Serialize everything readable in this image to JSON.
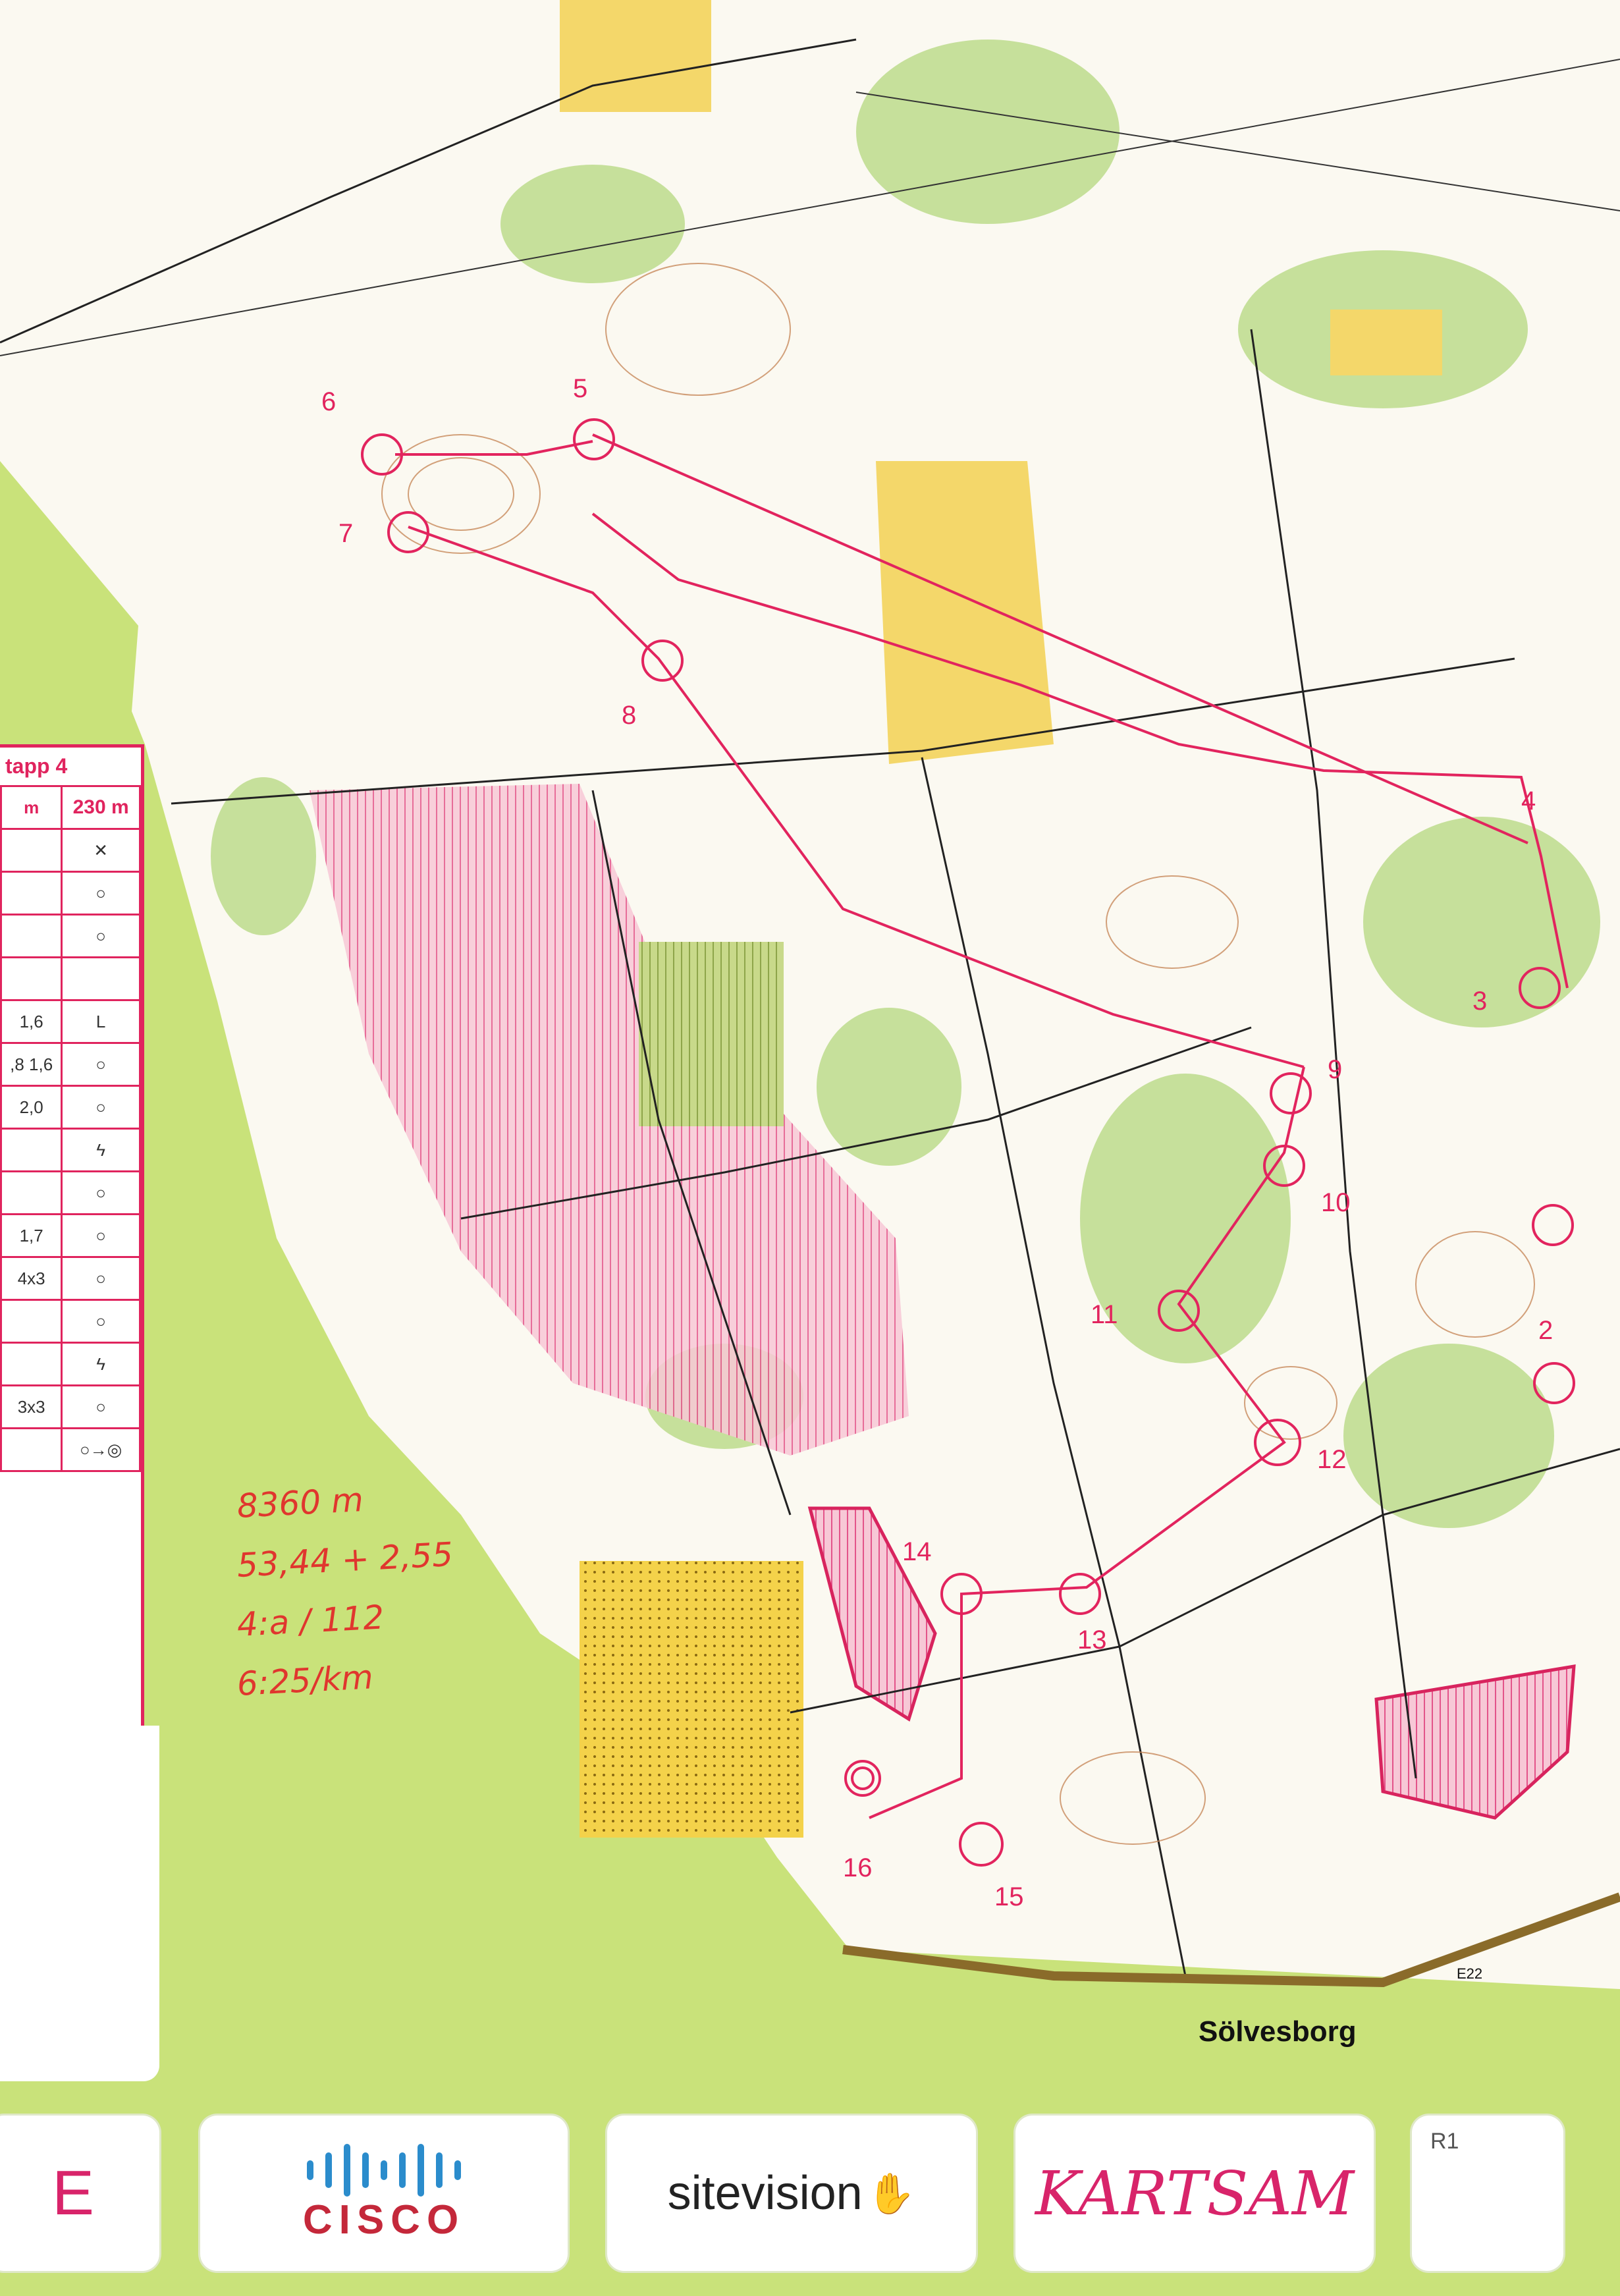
{
  "map": {
    "place_label": "Sölvesborg",
    "road_label": "E22"
  },
  "course": {
    "color": "#e2245e",
    "controls": [
      {
        "number": "2"
      },
      {
        "number": "3"
      },
      {
        "number": "4"
      },
      {
        "number": "5"
      },
      {
        "number": "6"
      },
      {
        "number": "7"
      },
      {
        "number": "8"
      },
      {
        "number": "9"
      },
      {
        "number": "10"
      },
      {
        "number": "11"
      },
      {
        "number": "12"
      },
      {
        "number": "13"
      },
      {
        "number": "14"
      },
      {
        "number": "15"
      },
      {
        "number": "16"
      }
    ]
  },
  "description_sheet": {
    "title": "tapp 4",
    "header_left": "m",
    "header_right": "230 m",
    "rows": [
      {
        "dim": "",
        "symbol": "✕"
      },
      {
        "dim": "",
        "symbol": "○"
      },
      {
        "dim": "",
        "symbol": "○"
      },
      {
        "dim": "",
        "symbol": ""
      },
      {
        "dim": "1,6",
        "symbol": "L"
      },
      {
        "dim": ",8 1,6",
        "symbol": "○"
      },
      {
        "dim": "2,0",
        "symbol": "○"
      },
      {
        "dim": "",
        "symbol": "ϟ"
      },
      {
        "dim": "",
        "symbol": "○"
      },
      {
        "dim": "1,7",
        "symbol": "○"
      },
      {
        "dim": "4x3",
        "symbol": "○"
      },
      {
        "dim": "",
        "symbol": "○"
      },
      {
        "dim": "",
        "symbol": "ϟ"
      },
      {
        "dim": "3x3",
        "symbol": "○"
      },
      {
        "dim": "",
        "symbol": "○→◎"
      }
    ]
  },
  "handwritten_notes": [
    "8360 m",
    "53,44 + 2,55",
    "4:a / 112",
    "6:25/km"
  ],
  "sponsors": {
    "partial": "E",
    "cisco": "CISCO",
    "sitevision": "sitevision",
    "kartsam": "KARTSAM",
    "r1": "R1"
  }
}
